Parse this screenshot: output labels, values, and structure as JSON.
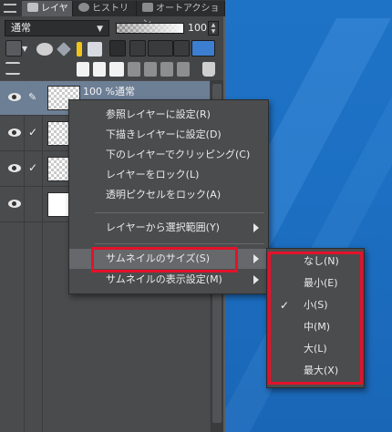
{
  "panel": {
    "tabs": [
      {
        "label": "レイヤー"
      },
      {
        "label": "ヒストリー"
      },
      {
        "label": "オートアクション"
      }
    ],
    "blend_mode": "通常",
    "opacity_value": "100",
    "layers": [
      {
        "name": "100 %通常",
        "visible": true,
        "checked": false,
        "thumb": "checker"
      },
      {
        "name": "",
        "visible": true,
        "checked": true,
        "thumb": "checker"
      },
      {
        "name": "",
        "visible": true,
        "checked": true,
        "thumb": "checker"
      },
      {
        "name": "",
        "visible": true,
        "checked": false,
        "thumb": "white"
      }
    ]
  },
  "context_menu": {
    "items": [
      {
        "label": "参照レイヤーに設定(R)"
      },
      {
        "label": "下描きレイヤーに設定(D)"
      },
      {
        "label": "下のレイヤーでクリッピング(C)"
      },
      {
        "label": "レイヤーをロック(L)"
      },
      {
        "label": "透明ピクセルをロック(A)"
      },
      {
        "label": "レイヤーから選択範囲(Y)",
        "submenu": true
      },
      {
        "label": "サムネイルのサイズ(S)",
        "submenu": true,
        "highlighted": true
      },
      {
        "label": "サムネイルの表示設定(M)",
        "submenu": true
      }
    ]
  },
  "thumbnail_size_menu": {
    "items": [
      {
        "label": "なし(N)"
      },
      {
        "label": "最小(E)"
      },
      {
        "label": "小(S)",
        "checked": true
      },
      {
        "label": "中(M)"
      },
      {
        "label": "大(L)"
      },
      {
        "label": "最大(X)"
      }
    ],
    "check_mark": "✓"
  },
  "colors": {
    "desktop": "#1c6fc2",
    "panel": "#444547",
    "menu": "#4b4c4e",
    "highlight": "#66686c",
    "annotation": "#e3122a"
  }
}
